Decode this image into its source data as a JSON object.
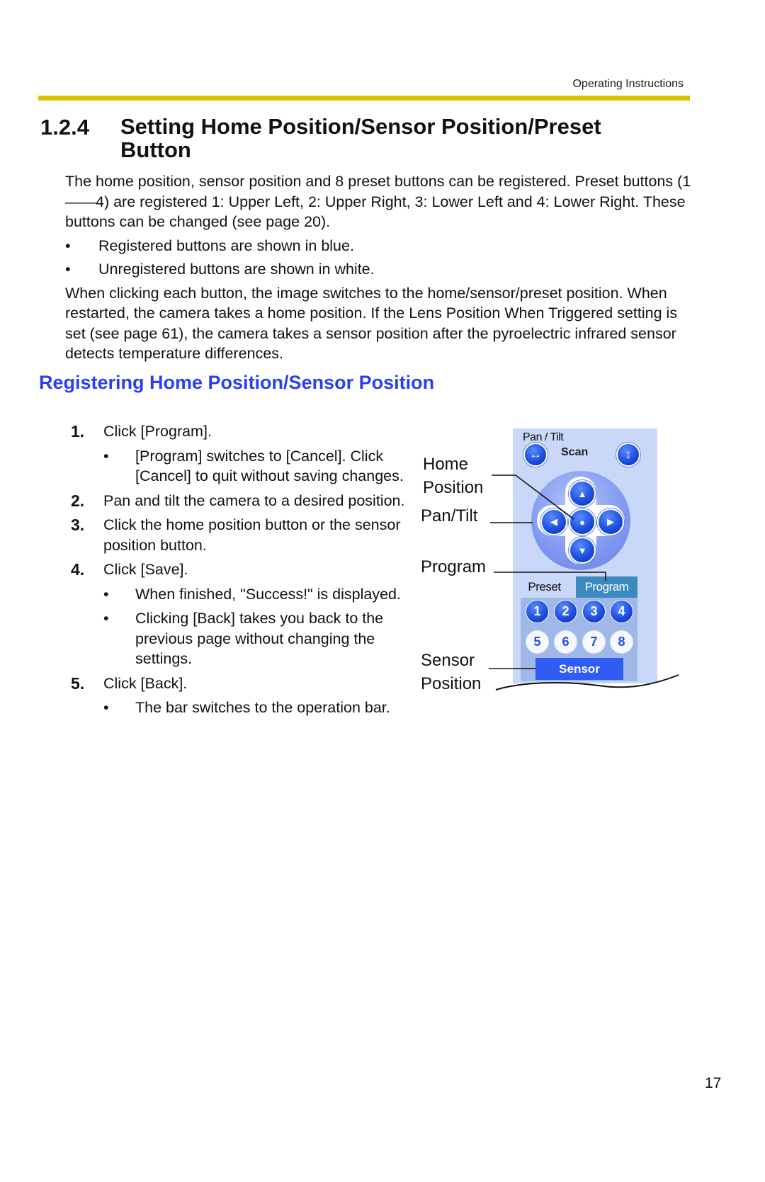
{
  "header": {
    "running_head": "Operating Instructions",
    "rule_color": "#d9c400"
  },
  "section": {
    "number": "1.2.4",
    "title": "Setting Home Position/Sensor Position/Preset Button"
  },
  "intro": {
    "paragraph1": "The home position, sensor position and 8 preset buttons can be registered. Preset buttons (1——4) are registered 1: Upper Left, 2: Upper Right, 3: Lower Left and 4: Lower Right. These buttons can be changed (see page 20).",
    "bullets": [
      "Registered buttons are shown in blue.",
      "Unregistered buttons are shown in white."
    ],
    "paragraph2": "When clicking each button, the image switches to the home/sensor/preset position. When restarted, the camera takes a home position. If the Lens Position When Triggered setting is set (see page 61), the camera takes a sensor position after the pyroelectric infrared sensor detects temperature differences."
  },
  "subheading": {
    "text": "Registering Home Position/Sensor Position",
    "color": "#2b3ef5"
  },
  "steps": [
    {
      "num": "1.",
      "text": "Click [Program].",
      "subs": [
        "[Program] switches to [Cancel]. Click [Cancel] to quit without saving changes."
      ]
    },
    {
      "num": "2.",
      "text": "Pan and tilt the camera to a desired position.",
      "subs": []
    },
    {
      "num": "3.",
      "text": "Click the home position button or the sensor position button.",
      "subs": []
    },
    {
      "num": "4.",
      "text": "Click [Save].",
      "subs": [
        "When finished, \"Success!\" is displayed.",
        "Clicking [Back] takes you back to the previous page without changing the settings."
      ]
    },
    {
      "num": "5.",
      "text": "Click [Back].",
      "subs": [
        "The bar switches to the operation bar."
      ]
    }
  ],
  "bullet_glyph": "•",
  "figure": {
    "callouts": {
      "home_line1": "Home",
      "home_line2": "Position",
      "pan_tilt": "Pan/Tilt",
      "program": "Program",
      "sensor_line1": "Sensor",
      "sensor_line2": "Position"
    },
    "panel": {
      "title": "Pan / Tilt",
      "scan_label": "Scan",
      "scan_left_icon": "horizontal-arrows-icon",
      "scan_right_icon": "vertical-arrows-icon",
      "dir_glyphs": {
        "up": "▲",
        "down": "▼",
        "left": "◀",
        "right": "▶",
        "home": "●",
        "h_scan": "↔",
        "v_scan": "↕"
      },
      "tab_preset": "Preset",
      "tab_program": "Program",
      "preset_buttons": [
        {
          "label": "1",
          "registered": true
        },
        {
          "label": "2",
          "registered": true
        },
        {
          "label": "3",
          "registered": true
        },
        {
          "label": "4",
          "registered": true
        },
        {
          "label": "5",
          "registered": false
        },
        {
          "label": "6",
          "registered": false
        },
        {
          "label": "7",
          "registered": false
        },
        {
          "label": "8",
          "registered": false
        }
      ],
      "sensor_button": "Sensor",
      "colors": {
        "panel_bg": "#c9d8f8",
        "program_tab": "#3a8abf",
        "grid_bg": "#9fb8e8",
        "sensor_button": "#2e5cf5",
        "registered": "#1e4fe0",
        "unregistered": "#f6f8ff"
      }
    }
  },
  "footer": {
    "page_number": "17"
  }
}
